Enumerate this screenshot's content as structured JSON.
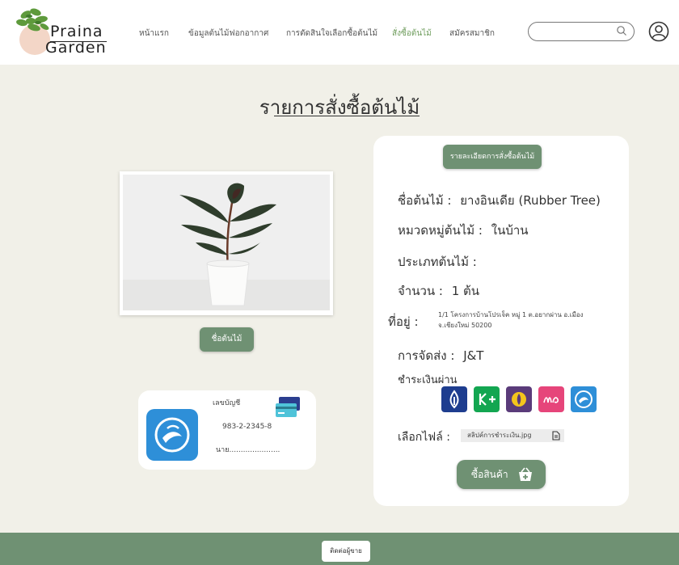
{
  "header": {
    "logo_line1": "Praina",
    "logo_line2": "Garden",
    "nav": [
      {
        "label": "หน้าแรก"
      },
      {
        "label": "ข้อมูลต้นไม้ฟอกอากาศ"
      },
      {
        "label": "การตัดสินใจเลือกซื้อต้นไม้"
      },
      {
        "label": "สั่งซื้อต้นไม้"
      },
      {
        "label": "สมัครสมาชิก"
      }
    ],
    "search_placeholder": "",
    "colors": {
      "active_nav": "#6f9d5d"
    }
  },
  "page": {
    "title": "รายการสั่งซื้อต้นไม้"
  },
  "left": {
    "plant_name_button": "ชื่อต้นไม้",
    "bank_card": {
      "account_label": "เลขบัญชี",
      "account_number": "983-2-2345-8",
      "account_name": "นาย......................"
    }
  },
  "panel": {
    "detail_button": "รายละเอียดการสั่งซื้อต้นไม้",
    "plant_name_label": "ชื่อต้นไม้ :",
    "plant_name_value": "ยางอินเดีย (Rubber Tree)",
    "category_label": "หมวดหมู่ต้นไม้ :",
    "category_value": "ในบ้าน",
    "type_label": "ประเภทต้นไม้ :",
    "type_value": "",
    "qty_label": "จำนวน :",
    "qty_value": "1 ต้น",
    "address_label": "ที่อยู่ :",
    "address_value": "1/1 โครงการบ้านโปรเจ็ค หมู่ 1 ต.อยากผ่าน อ.เมือง จ.เชียงใหม่ 50200",
    "shipping_label": "การจัดส่ง :",
    "shipping_value": "J&T",
    "payment_label": "ชำระเงินผ่าน",
    "payment_icons": [
      "bank-icon-blue",
      "kplus-icon",
      "scb-icon",
      "mymo-icon",
      "ktb-icon"
    ],
    "file_label": "เลือกไฟล์ :",
    "file_value": "สลิปค์การชำระเงิน.jpg",
    "buy_button": "ซื้อสินค้า"
  },
  "footer": {
    "contact_button": "ติดต่อผู้ขาย"
  }
}
